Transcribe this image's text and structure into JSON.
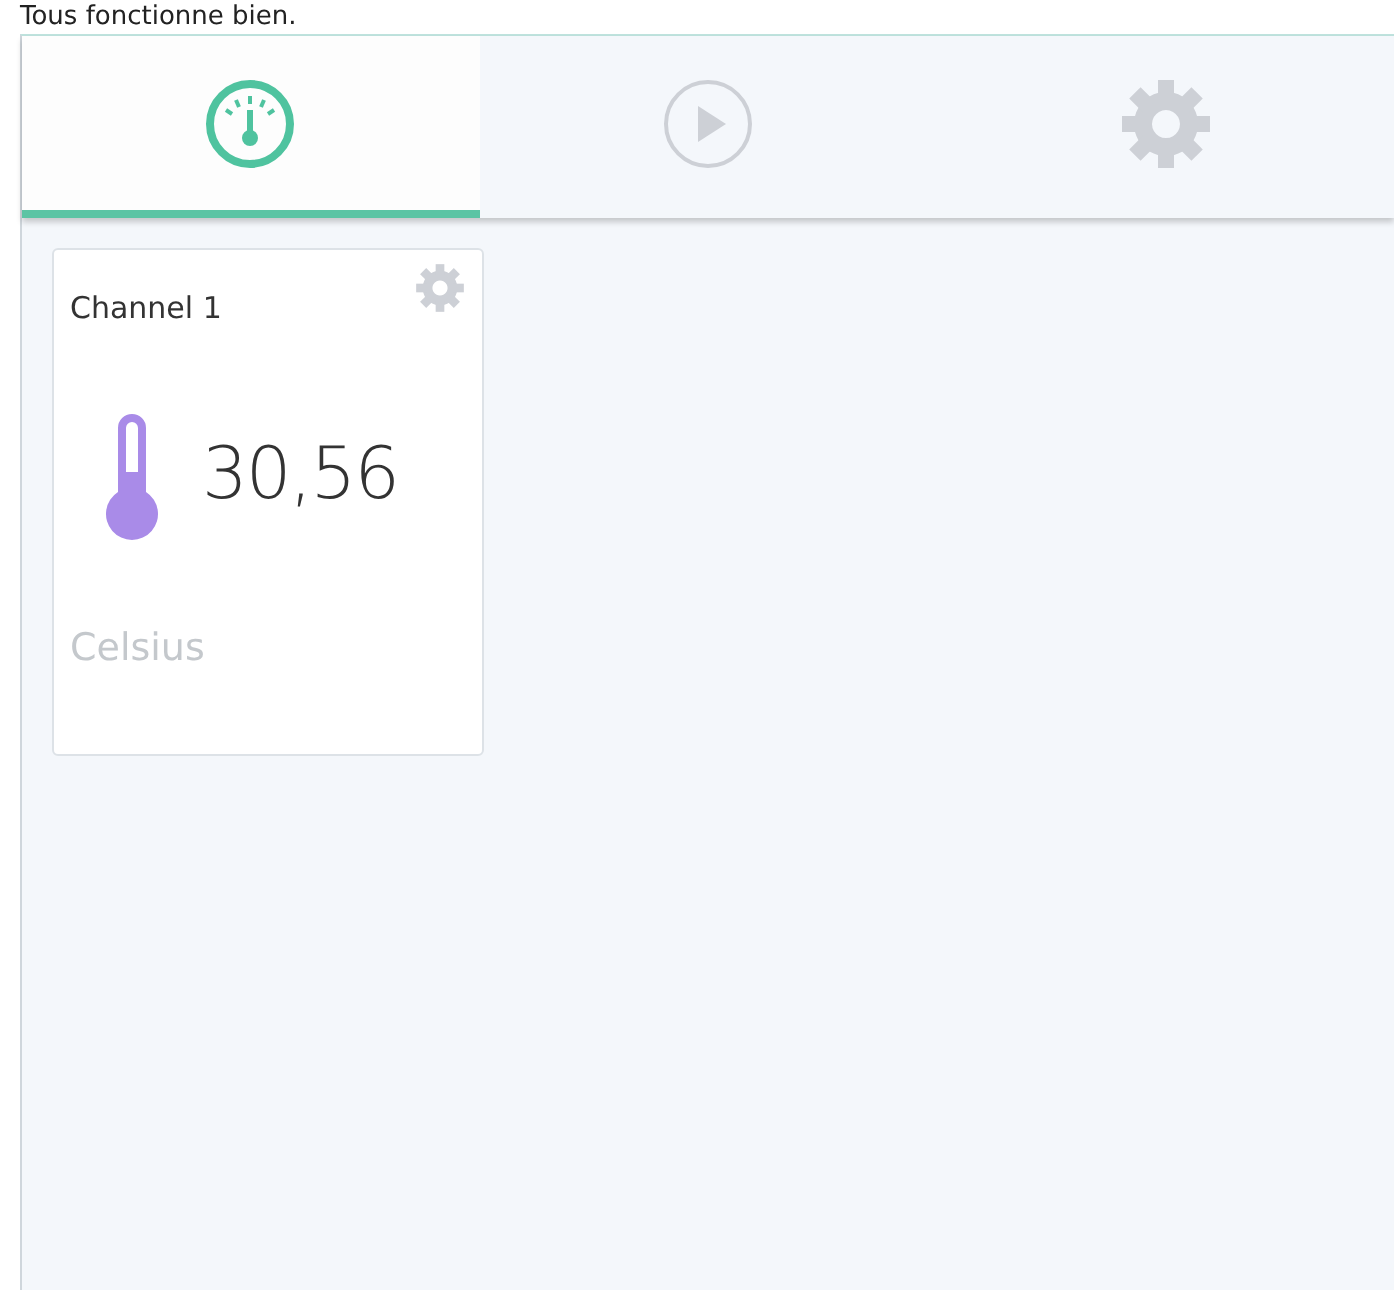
{
  "status_message": "Tous fonctionne bien.",
  "tabs": [
    {
      "kind": "gauge",
      "selected": true
    },
    {
      "kind": "play",
      "selected": false
    },
    {
      "kind": "gear",
      "selected": false
    }
  ],
  "channels": [
    {
      "name": "Channel 1",
      "value": "30,56",
      "unit": "Celsius"
    }
  ]
}
